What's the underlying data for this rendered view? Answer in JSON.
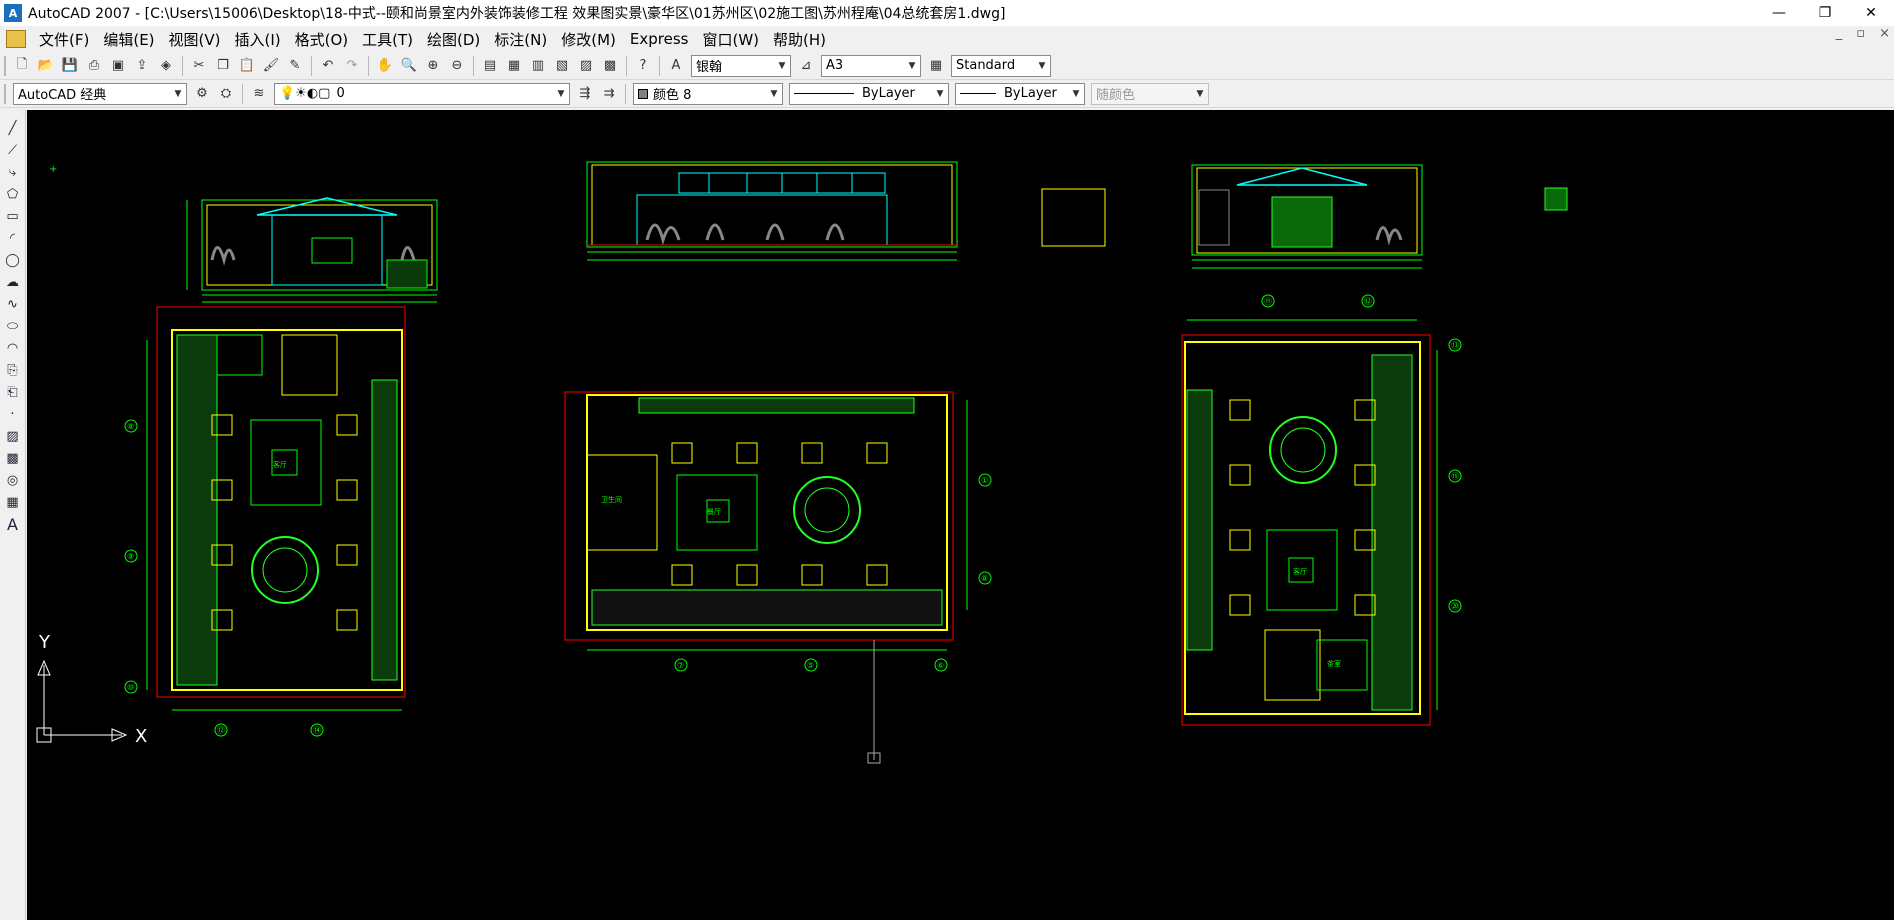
{
  "window": {
    "app_icon": "autocad-logo-icon",
    "title": "AutoCAD 2007 - [C:\\Users\\15006\\Desktop\\18-中式--颐和尚景室内外装饰装修工程 效果图实景\\豪华区\\01苏州区\\02施工图\\苏州程庵\\04总统套房1.dwg]",
    "controls": [
      "—",
      "❐",
      "✕"
    ]
  },
  "menu": {
    "doc_icon": "document-icon",
    "items": [
      "文件(F)",
      "编辑(E)",
      "视图(V)",
      "插入(I)",
      "格式(O)",
      "工具(T)",
      "绘图(D)",
      "标注(N)",
      "修改(M)",
      "Express",
      "窗口(W)",
      "帮助(H)"
    ],
    "mdi_controls": [
      "_",
      "▫",
      "×"
    ]
  },
  "toolbar_standard": {
    "text_style": "银翰",
    "dim_style": "A3",
    "table_style": "Standard"
  },
  "toolbar_properties": {
    "workspace": "AutoCAD 经典",
    "layer": "0",
    "color": "颜色 8",
    "linetype": "ByLayer",
    "lineweight": "ByLayer",
    "plot_style": "随颜色"
  },
  "canvas": {
    "ucs": {
      "y_label": "Y",
      "x_label": "X"
    },
    "grid_labels": {
      "left_plan": [
        "⑧",
        "⑨",
        "⑩",
        "⑫",
        "⑭"
      ],
      "center_plan": [
        "⑦",
        "⑤",
        "⑥",
        "①",
        "⑧"
      ],
      "right_plan": [
        "⑪",
        "⑫",
        "⑬",
        "⑮",
        "⑳"
      ]
    },
    "room_labels": [
      "景观区",
      "客厅",
      "餐厅",
      "卫生间",
      "卧室",
      "书房",
      "茶室",
      "更衣",
      "储藏"
    ]
  },
  "colors": {
    "canvas_bg": "#000000",
    "wall": "#ffff00",
    "planting": "#22ff22",
    "dims": "#00ff00",
    "frame": "#ff0000",
    "glass": "#00ffff"
  }
}
